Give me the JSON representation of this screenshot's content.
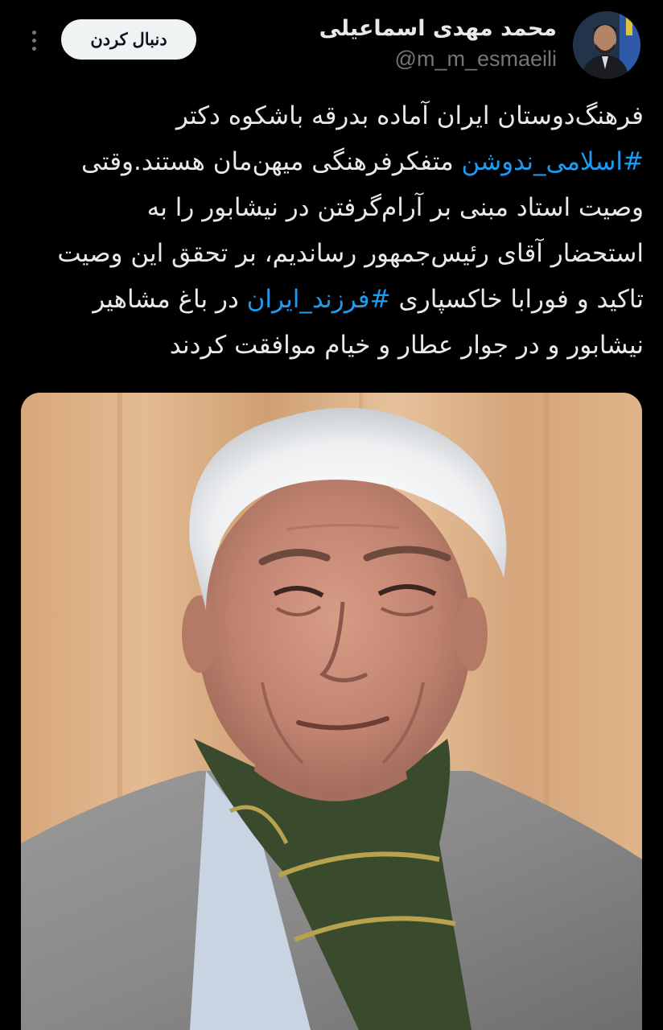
{
  "tweet": {
    "author_name": "محمد مهدی اسماعیلی",
    "author_handle": "@m_m_esmaeili",
    "follow_label": "دنبال کردن",
    "text_lines": [
      {
        "pre": "فرهنگ‌دوستان ایران آماده بدرقه باشکوه دکتر",
        "tag": "",
        "post": ""
      },
      {
        "pre": "",
        "tag": "#اسلامی_ندوشن",
        "post": " متفکرفرهنگی میهن‌مان هستند.وقتی"
      },
      {
        "pre": "وصیت استاد مبنی بر آرام‌گرفتن در نیشابور را به",
        "tag": "",
        "post": ""
      },
      {
        "pre": "استحضار آقای رئیس‌جمهور رساندیم، بر تحقق این وصیت",
        "tag": "",
        "post": ""
      },
      {
        "pre": "تاکید و فورابا خاکسپاری ",
        "tag": "#فرزند_ایران",
        "post": " در باغ مشاهیر"
      },
      {
        "pre": "نیشابور و در جوار عطار و خیام موافقت کردند",
        "tag": "",
        "post": ""
      }
    ]
  },
  "icons": {
    "more": "more-vertical-icon",
    "avatar": "profile-photo",
    "photo": "portrait-photo"
  },
  "colors": {
    "background": "#000000",
    "text": "#e7e9ea",
    "handle": "#71767b",
    "hashtag": "#1d9bf0",
    "button_bg": "#eff3f4"
  }
}
